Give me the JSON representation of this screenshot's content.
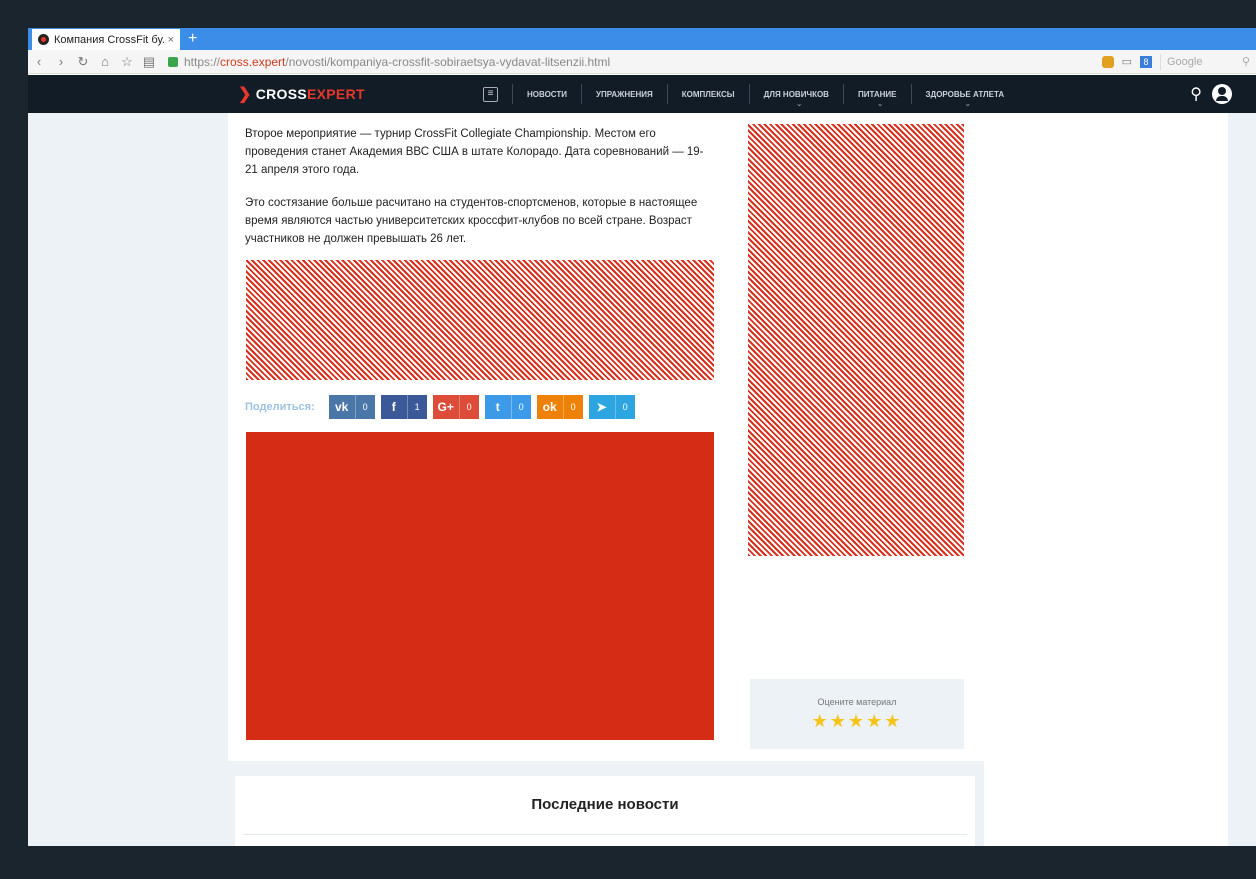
{
  "browser": {
    "tab_title": "Компания CrossFit бу...",
    "tab_close": "×",
    "new_tab": "+",
    "url_prefix": "https://",
    "url_host": "cross.expert",
    "url_path": "/novosti/kompaniya-crossfit-sobiraetsya-vydavat-litsenzii.html",
    "search_placeholder": "Google"
  },
  "site": {
    "logo_cross": "CROSS",
    "logo_expert": "EXPERT",
    "nav": [
      {
        "label": "НОВОСТИ"
      },
      {
        "label": "УПРАЖНЕНИЯ"
      },
      {
        "label": "КОМПЛЕКСЫ"
      },
      {
        "label": "ДЛЯ НОВИЧКОВ"
      },
      {
        "label": "ПИТАНИЕ"
      },
      {
        "label": "ЗДОРОВЬЕ АТЛЕТА"
      }
    ]
  },
  "article": {
    "paragraph1": "Второе мероприятие — турнир CrossFit Collegiate Championship. Местом его проведения станет Академия ВВС США в штате Колорадо. Дата соревнований — 19-21 апреля этого года.",
    "paragraph2": "Это состязание больше расчитано на студентов-спортсменов, которые в настоящее время являются частью университетских кроссфит-клубов по всей стране. Возраст участников не должен превышать 26 лет."
  },
  "share": {
    "label": "Поделиться:",
    "buttons": [
      {
        "icon": "vk-icon",
        "glyph": "vk",
        "count": "0",
        "color": "#4a76a8"
      },
      {
        "icon": "facebook-icon",
        "glyph": "f",
        "count": "1",
        "color": "#3b5998"
      },
      {
        "icon": "google-plus-icon",
        "glyph": "G+",
        "count": "0",
        "color": "#dd4b39"
      },
      {
        "icon": "twitter-icon",
        "glyph": "t",
        "count": "0",
        "color": "#3d9ae8"
      },
      {
        "icon": "odnoklassniki-icon",
        "glyph": "ok",
        "count": "0",
        "color": "#ee8208"
      },
      {
        "icon": "telegram-icon",
        "glyph": "➤",
        "count": "0",
        "color": "#2ca5e0"
      }
    ]
  },
  "rating": {
    "label": "Оцените материал",
    "stars": 5
  },
  "latest_news": {
    "title": "Последние новости"
  }
}
